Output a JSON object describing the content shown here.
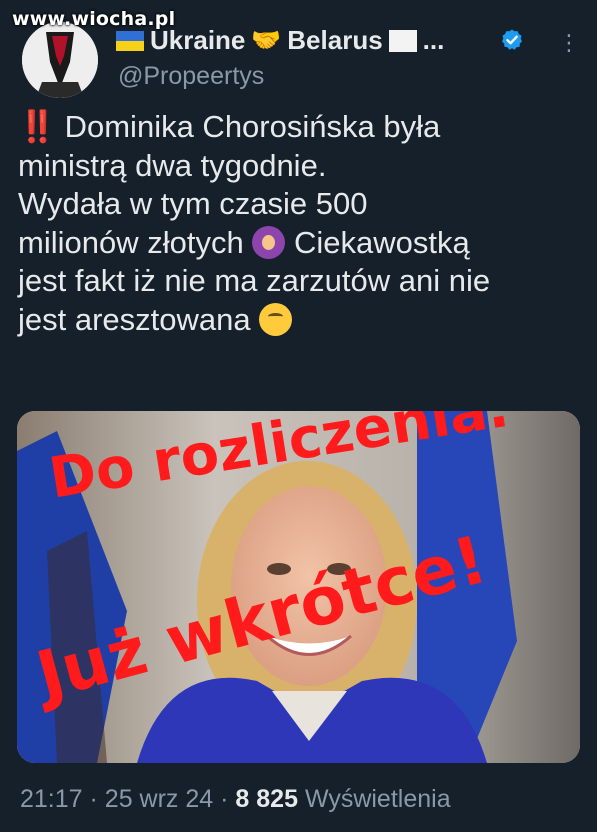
{
  "watermark": "www.wiocha.pl",
  "author": {
    "display_name_1": "Ukraine",
    "display_name_2": "Belarus",
    "display_name_end": "...",
    "handle": "@Propeertys",
    "verified": true,
    "icons": [
      "ukraine-flag-icon",
      "handshake-icon",
      "white-flag-icon",
      "verified-badge-icon",
      "more-options-icon"
    ]
  },
  "tweet": {
    "prefix": "‼️",
    "line_1": "Dominika Chorosińska była",
    "line_2": "ministrą dwa tygodnie.",
    "line_3": "Wydała w tym czasie 500",
    "line_4a": "milionów złotych",
    "line_4b": "Ciekawostką",
    "line_5": "jest fakt iż nie ma zarzutów ani nie",
    "line_6": "jest aresztowana"
  },
  "media": {
    "overlay_top": "Do rozliczenia.",
    "overlay_bottom": "Już wkrótce!"
  },
  "meta": {
    "time": "21:17",
    "sep_1": "·",
    "date": "25 wrz 24",
    "sep_2": "·",
    "views_count": "8 825",
    "views_label": "Wyświetlenia"
  },
  "colors": {
    "background": "#15202b",
    "text": "#e7e9ea",
    "secondary": "#8b98a5",
    "verified": "#1d9bf0",
    "overlay_red": "#ff1b1b"
  }
}
